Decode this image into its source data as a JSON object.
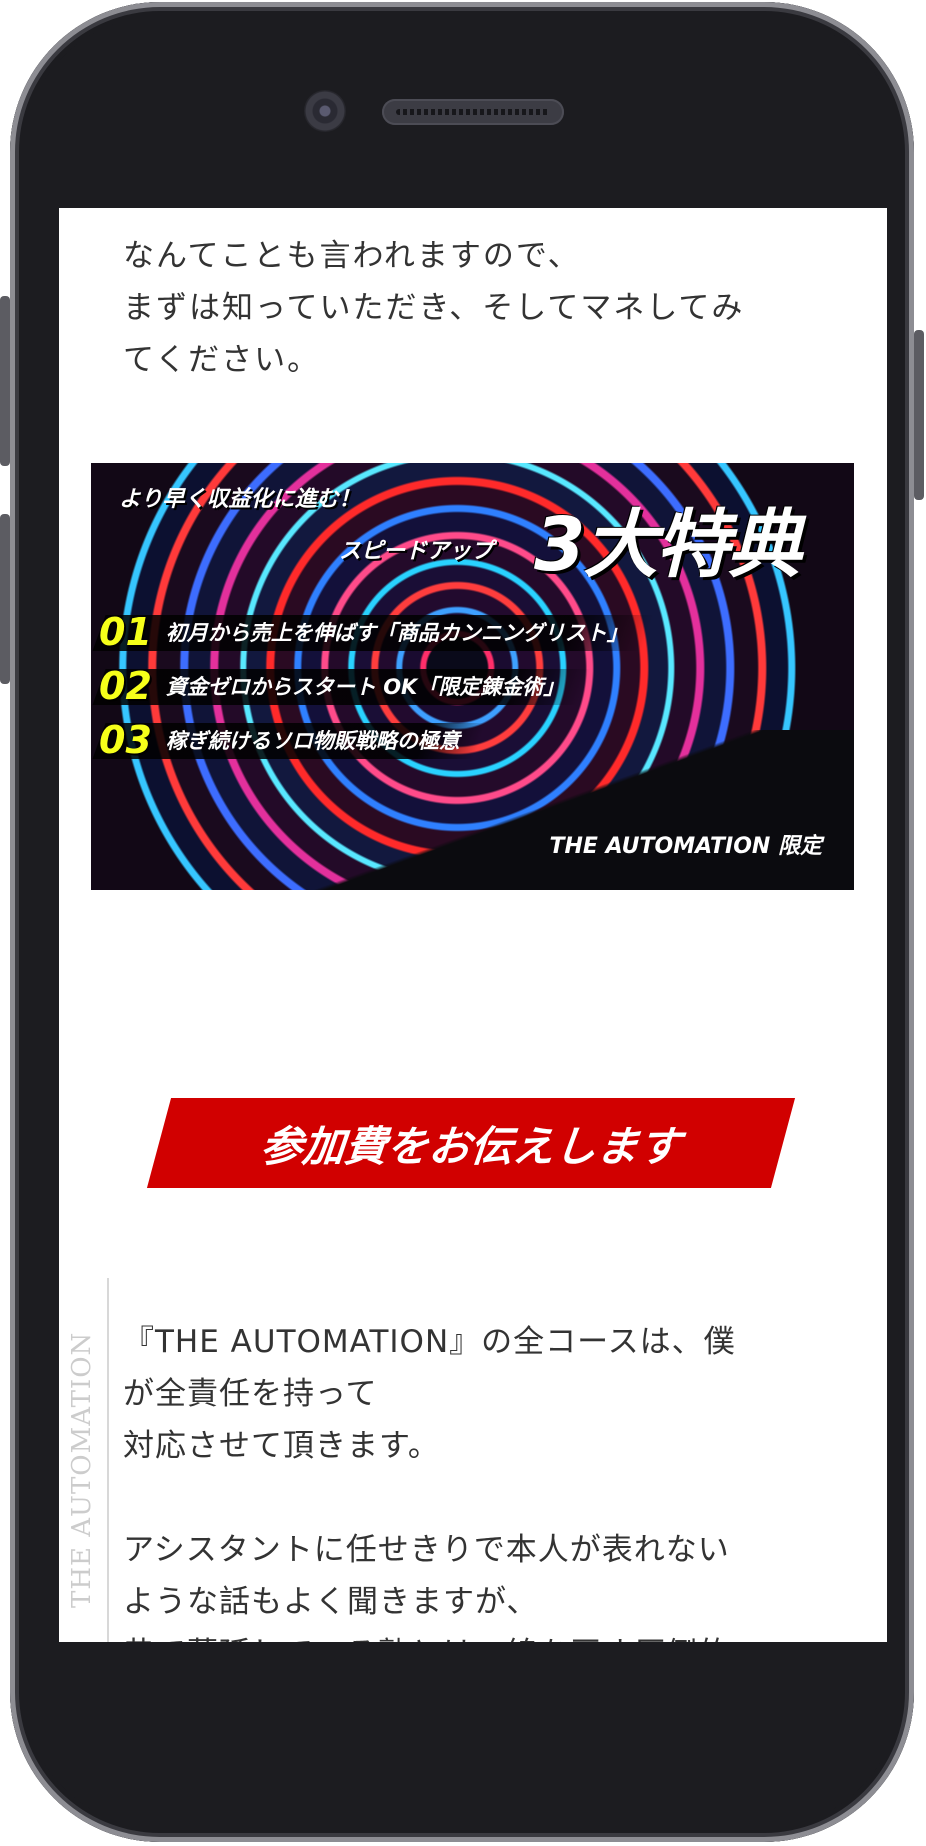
{
  "intro": {
    "lines": [
      "なんてことも言われますので、",
      "まずは知っていただき、そしてマネしてみ",
      "てください。"
    ]
  },
  "banner": {
    "subtitle": "より早く収益化に進む！",
    "speedup": "スピードアップ",
    "big_title": "3大特典",
    "items": [
      {
        "num": "01",
        "text": "初月から売上を伸ばす「商品カンニングリスト」"
      },
      {
        "num": "02",
        "text": "資金ゼロからスタート OK「限定錬金術」"
      },
      {
        "num": "03",
        "text": "稼ぎ続けるソロ物販戦略の極意"
      }
    ],
    "limited": "THE AUTOMATION 限定"
  },
  "cta_heading": "参加費をお伝えします",
  "side_label": "THE AUTOMATION",
  "body": {
    "para1": [
      "『THE AUTOMATION』の全コースは、僕",
      "が全責任を持って",
      "対応させて頂きます。"
    ],
    "para2": [
      "アシスタントに任せきりで本人が表れない",
      "ような話もよく聞きますが、",
      "巷で蔓延している塾とは一線を画す圧倒的"
    ]
  }
}
